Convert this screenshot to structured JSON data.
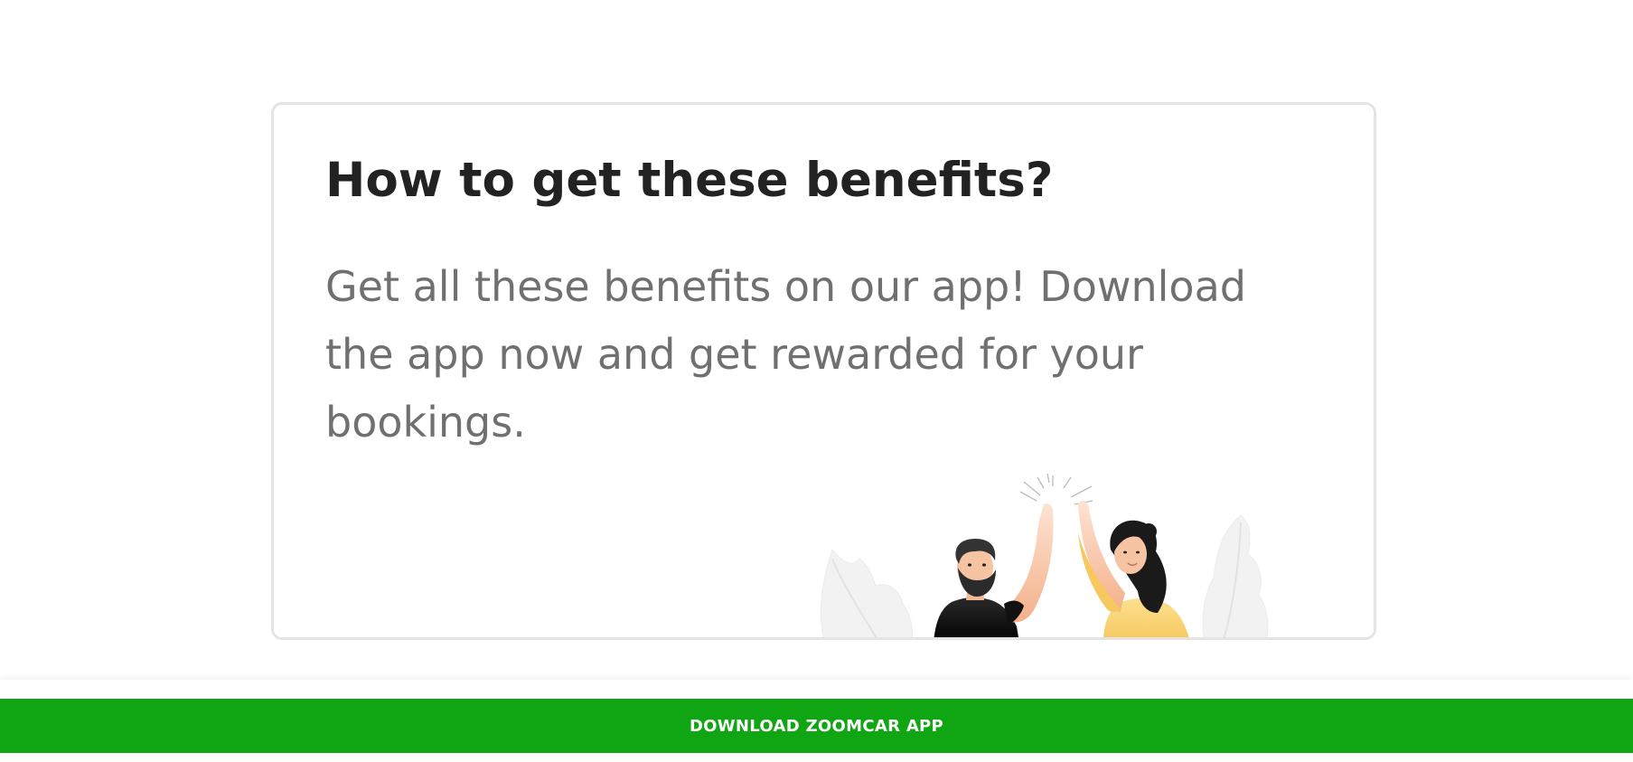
{
  "benefits_card": {
    "title": "How to get these benefits?",
    "description": "Get all these benefits on our app! Download the app now and get rewarded for your bookings.",
    "illustration": "high-five-illustration"
  },
  "bottom_bar": {
    "download_label": "DOWNLOAD ZOOMCAR APP",
    "button_color": "#10a513"
  },
  "colors": {
    "title": "#222222",
    "body": "#707070",
    "card_border": "#e4e4e4"
  }
}
